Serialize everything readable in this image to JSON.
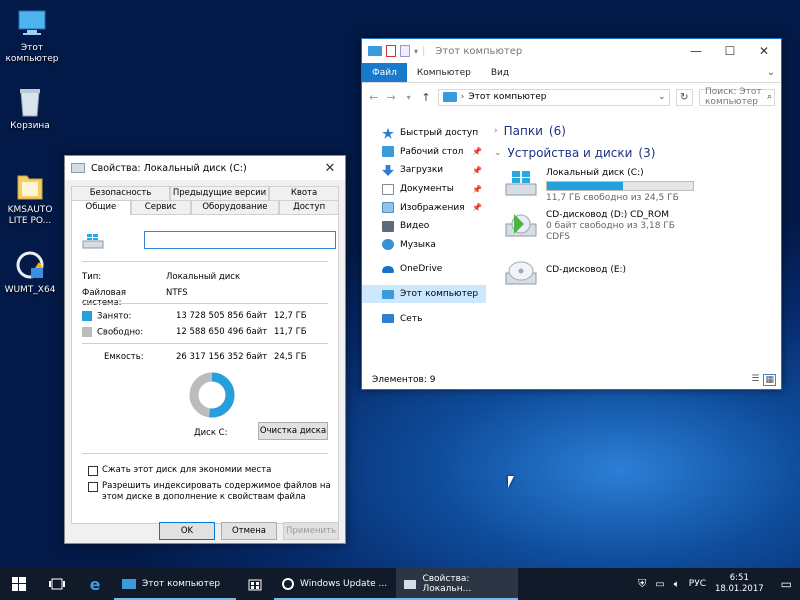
{
  "desktop": {
    "icons": [
      {
        "label": "Этот компьютер",
        "icon": "this-pc-icon"
      },
      {
        "label": "Корзина",
        "icon": "recycle-bin-icon"
      },
      {
        "label": "KMSAUTO LITE PO...",
        "icon": "folder-icon"
      },
      {
        "label": "WUMT_X64",
        "icon": "windows-update-icon"
      }
    ]
  },
  "explorer": {
    "title": "Этот компьютер",
    "ribbon_tabs": [
      "Файл",
      "Компьютер",
      "Вид"
    ],
    "address": "Этот компьютер",
    "search_placeholder": "Поиск: Этот компьютер",
    "nav_items": [
      {
        "label": "Быстрый доступ",
        "icon": "star-icon",
        "pinned": false
      },
      {
        "label": "Рабочий стол",
        "icon": "desktop-icon",
        "pinned": true
      },
      {
        "label": "Загрузки",
        "icon": "downloads-icon",
        "pinned": true
      },
      {
        "label": "Документы",
        "icon": "documents-icon",
        "pinned": true
      },
      {
        "label": "Изображения",
        "icon": "pictures-icon",
        "pinned": true
      },
      {
        "label": "Видео",
        "icon": "video-icon",
        "pinned": false
      },
      {
        "label": "Музыка",
        "icon": "music-icon",
        "pinned": false
      },
      {
        "label": "OneDrive",
        "icon": "onedrive-icon",
        "pinned": false
      },
      {
        "label": "Этот компьютер",
        "icon": "this-pc-icon",
        "pinned": false,
        "selected": true
      },
      {
        "label": "Сеть",
        "icon": "network-icon",
        "pinned": false
      }
    ],
    "groups": [
      {
        "title": "Папки",
        "count": "(6)"
      },
      {
        "title": "Устройства и диски",
        "count": "(3)"
      }
    ],
    "drives": [
      {
        "name": "Локальный диск (C:)",
        "detail": "11,7 ГБ свободно из 24,5 ГБ",
        "fs": "",
        "used_fraction": 0.52,
        "icon": "local-disk-icon"
      },
      {
        "name": "CD-дисковод (D:) CD_ROM",
        "detail": "0 байт свободно из 3,18 ГБ",
        "fs": "CDFS",
        "icon": "cd-setup-icon"
      },
      {
        "name": "CD-дисковод (E:)",
        "detail": "",
        "fs": "",
        "icon": "cd-drive-icon"
      }
    ],
    "status": "Элементов: 9"
  },
  "props": {
    "title": "Свойства: Локальный диск (C:)",
    "tabs_row1": [
      "Безопасность",
      "Предыдущие версии",
      "Квота"
    ],
    "tabs_row2": [
      "Общие",
      "Сервис",
      "Оборудование",
      "Доступ"
    ],
    "name_value": "",
    "type_label": "Тип:",
    "type_value": "Локальный диск",
    "fs_label": "Файловая система:",
    "fs_value": "NTFS",
    "used_label": "Занято:",
    "used_bytes": "13 728 505 856 байт",
    "used_gb": "12,7 ГБ",
    "free_label": "Свободно:",
    "free_bytes": "12 588 650 496 байт",
    "free_gb": "11,7 ГБ",
    "cap_label": "Емкость:",
    "cap_bytes": "26 317 156 352 байт",
    "cap_gb": "24,5 ГБ",
    "used_fraction": 0.52,
    "used_color": "#26a0da",
    "free_color": "#bcbcbc",
    "disk_label": "Диск C:",
    "cleanup_button": "Очистка диска",
    "compress_label": "Сжать этот диск для экономии места",
    "index_label": "Разрешить индексировать содержимое файлов на этом диске в дополнение к свойствам файла",
    "ok": "OK",
    "cancel": "Отмена",
    "apply": "Применить"
  },
  "taskbar": {
    "apps": [
      {
        "label": "Этот компьютер",
        "icon": "explorer-icon"
      },
      {
        "label": "Windows Update ...",
        "icon": "windows-update-icon"
      },
      {
        "label": "Свойства: Локальн...",
        "icon": "drive-properties-icon",
        "active": true
      }
    ],
    "lang": "РУС",
    "time": "6:51",
    "date": "18.01.2017"
  }
}
